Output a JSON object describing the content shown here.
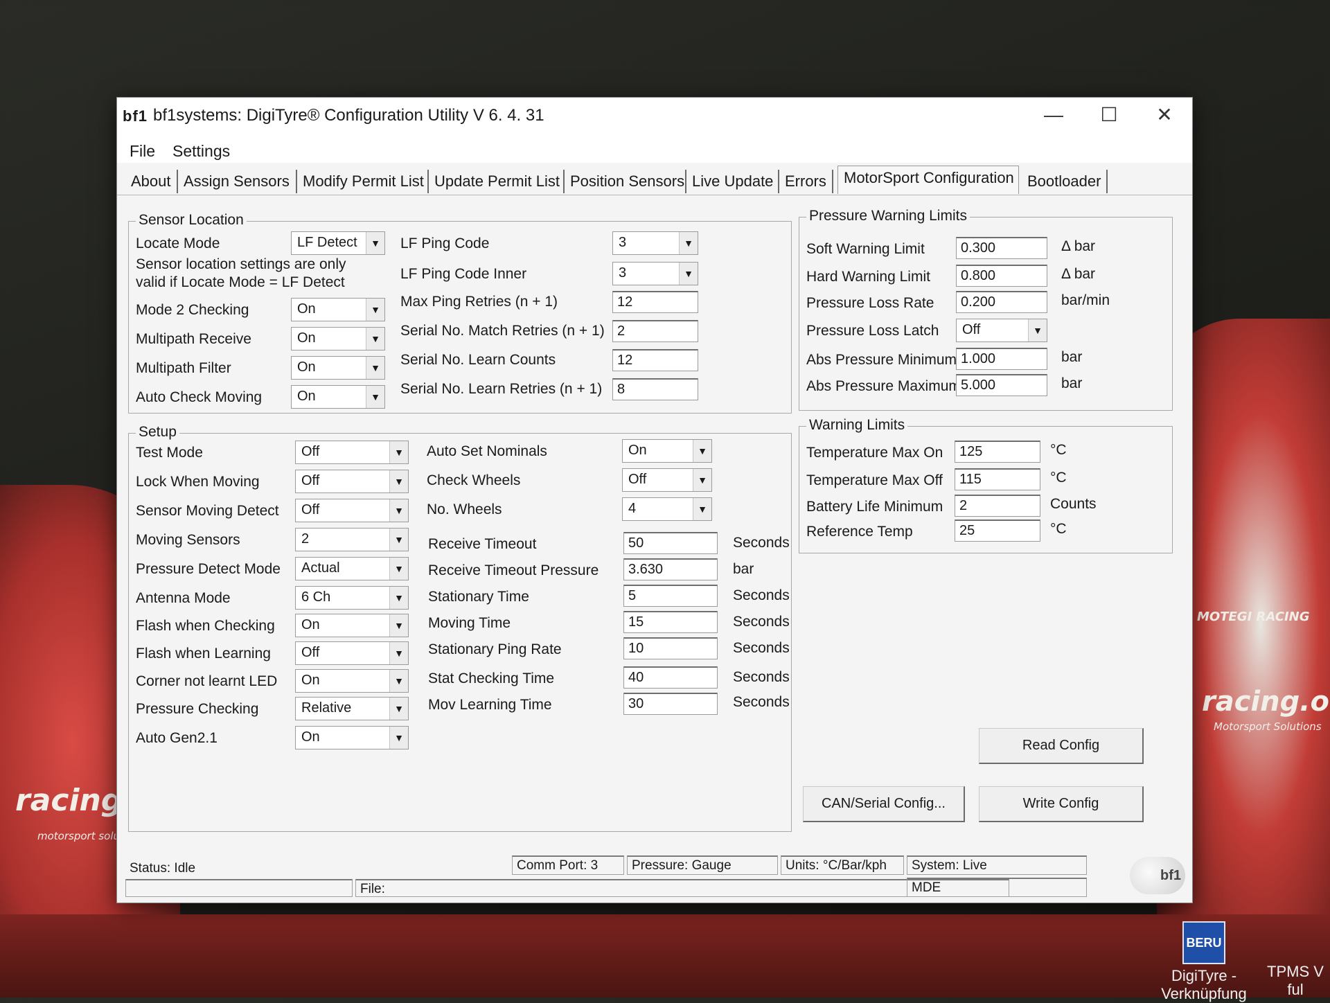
{
  "window": {
    "logo": "bf1",
    "title": "bf1systems: DigiTyre® Configuration Utility V 6. 4. 31",
    "minimize_icon": "minimize-icon",
    "maximize_icon": "maximize-icon",
    "close_icon": "close-icon"
  },
  "menu": {
    "file": "File",
    "settings": "Settings"
  },
  "tabs": [
    {
      "label": "About"
    },
    {
      "label": "Assign Sensors"
    },
    {
      "label": "Modify Permit List"
    },
    {
      "label": "Update Permit List"
    },
    {
      "label": "Position Sensors"
    },
    {
      "label": "Live Update"
    },
    {
      "label": "Errors"
    },
    {
      "label": "MotorSport Configuration",
      "active": true
    },
    {
      "label": "Bootloader"
    }
  ],
  "sensor_location": {
    "title": "Sensor Location",
    "locate_mode_label": "Locate Mode",
    "locate_mode_value": "LF Detect",
    "note_line1": "Sensor location settings are only",
    "note_line2": "valid if Locate Mode = LF Detect",
    "mode2_label": "Mode 2 Checking",
    "mode2_value": "On",
    "multipath_receive_label": "Multipath Receive",
    "multipath_receive_value": "On",
    "multipath_filter_label": "Multipath Filter",
    "multipath_filter_value": "On",
    "auto_check_label": "Auto Check Moving",
    "auto_check_value": "On",
    "lf_ping_code_label": "LF Ping Code",
    "lf_ping_code_value": "3",
    "lf_ping_inner_label": "LF Ping Code Inner",
    "lf_ping_inner_value": "3",
    "max_ping_label": "Max Ping Retries (n + 1)",
    "max_ping_value": "12",
    "serial_match_label": "Serial No. Match Retries (n + 1)",
    "serial_match_value": "2",
    "serial_learn_counts_label": "Serial No. Learn Counts",
    "serial_learn_counts_value": "12",
    "serial_learn_retries_label": "Serial No. Learn Retries (n + 1)",
    "serial_learn_retries_value": "8"
  },
  "setup": {
    "title": "Setup",
    "left": [
      {
        "label": "Test Mode",
        "value": "Off"
      },
      {
        "label": "Lock When Moving",
        "value": "Off"
      },
      {
        "label": "Sensor Moving Detect",
        "value": "Off"
      },
      {
        "label": "Moving Sensors",
        "value": "2"
      },
      {
        "label": "Pressure Detect Mode",
        "value": "Actual"
      },
      {
        "label": "Antenna Mode",
        "value": "6 Ch"
      },
      {
        "label": "Flash when Checking",
        "value": "On"
      },
      {
        "label": "Flash when Learning",
        "value": "Off"
      },
      {
        "label": "Corner not learnt LED",
        "value": "On"
      },
      {
        "label": "Pressure Checking",
        "value": "Relative"
      },
      {
        "label": "Auto Gen2.1",
        "value": "On"
      }
    ],
    "dropdowns": [
      {
        "label": "Auto Set Nominals",
        "value": "On"
      },
      {
        "label": "Check Wheels",
        "value": "Off"
      },
      {
        "label": "No. Wheels",
        "value": "4"
      }
    ],
    "timings": [
      {
        "label": "Receive Timeout",
        "value": "50",
        "unit": "Seconds"
      },
      {
        "label": "Receive Timeout Pressure",
        "value": "3.630",
        "unit": "bar"
      },
      {
        "label": "Stationary Time",
        "value": "5",
        "unit": "Seconds"
      },
      {
        "label": "Moving Time",
        "value": "15",
        "unit": "Seconds"
      },
      {
        "label": "Stationary Ping Rate",
        "value": "10",
        "unit": "Seconds"
      },
      {
        "label": "Stat Checking Time",
        "value": "40",
        "unit": "Seconds"
      },
      {
        "label": "Mov Learning Time",
        "value": "30",
        "unit": "Seconds"
      }
    ]
  },
  "pressure_limits": {
    "title": "Pressure Warning Limits",
    "soft_label": "Soft Warning Limit",
    "soft_value": "0.300",
    "soft_unit": "Δ  bar",
    "hard_label": "Hard Warning Limit",
    "hard_value": "0.800",
    "hard_unit": "Δ  bar",
    "loss_rate_label": "Pressure Loss Rate",
    "loss_rate_value": "0.200",
    "loss_rate_unit": "bar/min",
    "loss_latch_label": "Pressure Loss Latch",
    "loss_latch_value": "Off",
    "abs_min_label": "Abs Pressure Minimum",
    "abs_min_value": "1.000",
    "abs_min_unit": "bar",
    "abs_max_label": "Abs Pressure Maximum",
    "abs_max_value": "5.000",
    "abs_max_unit": "bar"
  },
  "warning_limits": {
    "title": "Warning Limits",
    "rows": [
      {
        "label": "Temperature Max On",
        "value": "125",
        "unit": "°C"
      },
      {
        "label": "Temperature Max Off",
        "value": "115",
        "unit": "°C"
      },
      {
        "label": "Battery Life Minimum",
        "value": "2",
        "unit": "Counts"
      },
      {
        "label": "Reference Temp",
        "value": "25",
        "unit": "°C"
      }
    ]
  },
  "buttons": {
    "read_config": "Read Config",
    "can_serial": "CAN/Serial Config...",
    "write_config": "Write Config"
  },
  "statusbar": {
    "status": "Status: Idle",
    "file": "File:",
    "comm_port": "Comm Port: 3",
    "pressure": "Pressure: Gauge",
    "units": "Units: °C/Bar/kph",
    "system": "System: Live",
    "mode": "MDE",
    "logo": "bf1"
  },
  "desktop": {
    "icon1_label": "DigiTyre -",
    "icon1_sub": "Verknüpfung",
    "icon1_badge": "BERU",
    "icon2_label": "TPMS V",
    "icon2_sub": "ful",
    "brand_left": "racing.one",
    "brand_right": "racing.one",
    "brand_right_sub": "Motorsport Solutions",
    "brand_left_sub": "motorsport solutions",
    "brand_car": "MOTEGI RACING"
  }
}
